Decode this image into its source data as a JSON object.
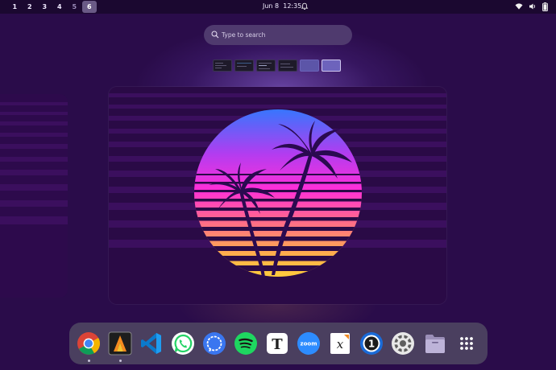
{
  "topbar": {
    "workspaces": [
      "1",
      "2",
      "3",
      "4",
      "5",
      "6"
    ],
    "active_workspace": "6",
    "date": "Jun 8",
    "time": "12:35"
  },
  "search": {
    "placeholder": "Type to search"
  },
  "dock": {
    "apps": [
      {
        "name": "Google Chrome",
        "icon": "chrome-icon"
      },
      {
        "name": "Alacritty",
        "icon": "alacritty-icon"
      },
      {
        "name": "Visual Studio Code",
        "icon": "vscode-icon"
      },
      {
        "name": "WhatsApp",
        "icon": "whatsapp-icon"
      },
      {
        "name": "Signal",
        "icon": "signal-icon"
      },
      {
        "name": "Spotify",
        "icon": "spotify-icon"
      },
      {
        "name": "Typora",
        "icon": "typora-icon",
        "glyph": "T"
      },
      {
        "name": "Zoom",
        "icon": "zoom-icon",
        "glyph": "zoom"
      },
      {
        "name": "Xournal++",
        "icon": "xournal-icon",
        "glyph": "x"
      },
      {
        "name": "1Password",
        "icon": "onepassword-icon",
        "glyph": "1"
      },
      {
        "name": "Settings",
        "icon": "settings-icon"
      },
      {
        "name": "Files",
        "icon": "files-icon"
      },
      {
        "name": "Show Applications",
        "icon": "app-grid-icon"
      }
    ]
  },
  "colors": {
    "background": "#2a0c4a",
    "sun_top": "#2a7cff",
    "sun_mid": "#ff2fd8",
    "sun_bottom": "#ffd23a",
    "dock": "#4a3f5f"
  }
}
